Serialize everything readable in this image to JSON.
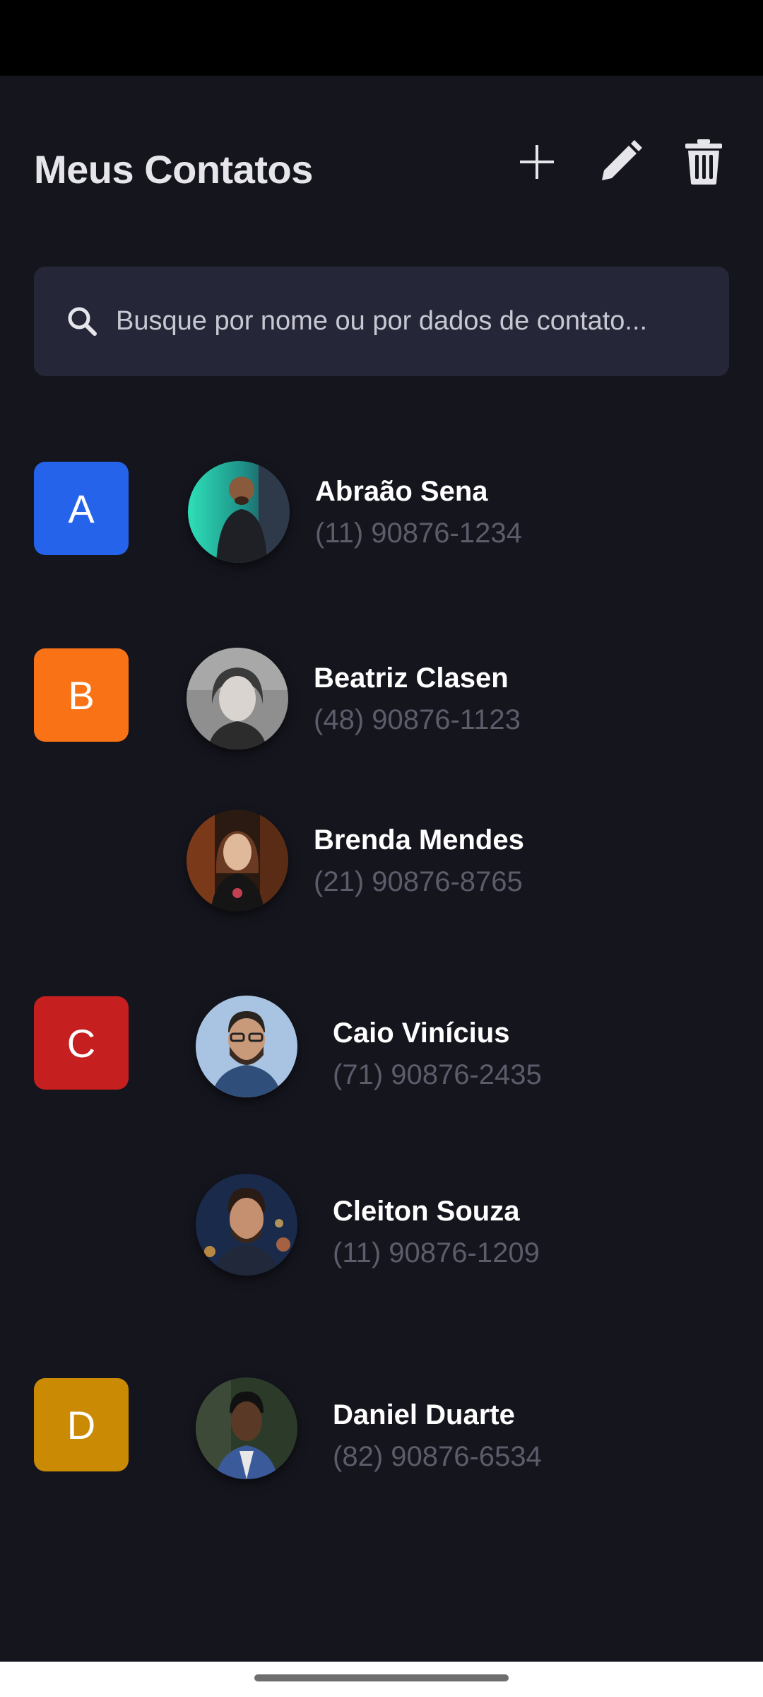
{
  "header": {
    "title": "Meus Contatos",
    "add_icon": "plus-icon",
    "edit_icon": "pencil-icon",
    "delete_icon": "trash-icon"
  },
  "search": {
    "placeholder": "Busque por nome ou por dados de contato...",
    "icon": "search-icon"
  },
  "colors": {
    "background": "#15151e",
    "search_bg": "#252638",
    "letter_A": "#2563eb",
    "letter_B": "#f97316",
    "letter_C": "#c51f1f",
    "letter_D": "#ca8a04",
    "phone_text": "#5c5c6a"
  },
  "groups": [
    {
      "letter": "A",
      "contacts": [
        {
          "name": "Abraão Sena",
          "phone": "(11) 90876-1234"
        }
      ]
    },
    {
      "letter": "B",
      "contacts": [
        {
          "name": "Beatriz Clasen",
          "phone": "(48) 90876-1123"
        },
        {
          "name": "Brenda Mendes",
          "phone": "(21) 90876-8765"
        }
      ]
    },
    {
      "letter": "C",
      "contacts": [
        {
          "name": "Caio Vinícius",
          "phone": "(71) 90876-2435"
        },
        {
          "name": "Cleiton Souza",
          "phone": "(11) 90876-1209"
        }
      ]
    },
    {
      "letter": "D",
      "contacts": [
        {
          "name": "Daniel Duarte",
          "phone": "(82) 90876-6534"
        }
      ]
    }
  ]
}
